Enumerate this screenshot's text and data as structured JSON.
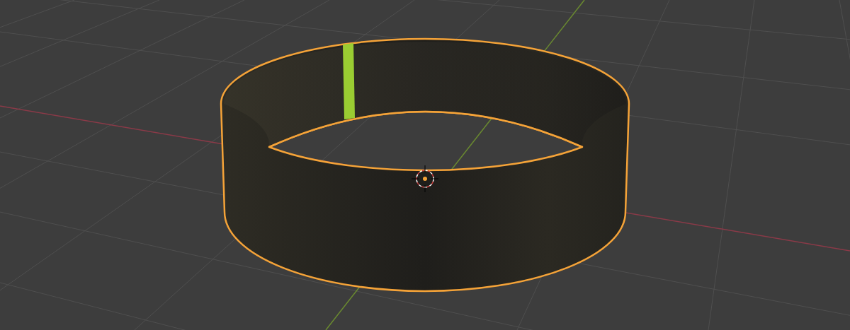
{
  "viewport": {
    "object": {
      "selected": true,
      "active_face": true
    }
  }
}
